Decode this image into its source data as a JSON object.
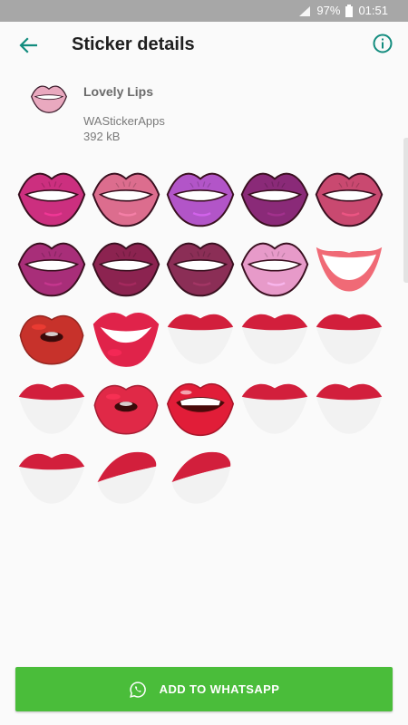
{
  "status_bar": {
    "battery": "97%",
    "time": "01:51"
  },
  "app_bar": {
    "title": "Sticker details"
  },
  "pack": {
    "name": "Lovely Lips",
    "publisher": "WAStickerApps",
    "size": "392 kB"
  },
  "stickers": [
    {
      "style": "plain",
      "color": "#cc2f7f"
    },
    {
      "style": "plain",
      "color": "#dc6d8e"
    },
    {
      "style": "plain",
      "color": "#b255c8"
    },
    {
      "style": "plain",
      "color": "#8a2a78"
    },
    {
      "style": "plain",
      "color": "#c94970"
    },
    {
      "style": "plain",
      "color": "#a82e79"
    },
    {
      "style": "plain",
      "color": "#8c2350"
    },
    {
      "style": "plain",
      "color": "#8b2e56"
    },
    {
      "style": "plain",
      "color": "#e79ac9"
    },
    {
      "style": "smile",
      "color": "#f06a76"
    },
    {
      "style": "kiss",
      "color": "#c7322b"
    },
    {
      "style": "open",
      "color": "#e0234a"
    },
    {
      "style": "mouth",
      "color": "#d21f3c"
    },
    {
      "style": "mouth",
      "color": "#d21f3c"
    },
    {
      "style": "mouth",
      "color": "#d21f3c"
    },
    {
      "style": "mouth",
      "color": "#d21f3c"
    },
    {
      "style": "kiss",
      "color": "#e02947"
    },
    {
      "style": "teeth",
      "color": "#e11d38"
    },
    {
      "style": "mouth",
      "color": "#d21f3c"
    },
    {
      "style": "mouth",
      "color": "#d21f3c"
    },
    {
      "style": "mouth",
      "color": "#d21f3c"
    },
    {
      "style": "side",
      "color": "#d21f3c"
    },
    {
      "style": "side",
      "color": "#d21f3c"
    }
  ],
  "add_button": {
    "label": "ADD TO WHATSAPP"
  },
  "colors": {
    "accent": "#128c7e",
    "button": "#4abd3a"
  }
}
